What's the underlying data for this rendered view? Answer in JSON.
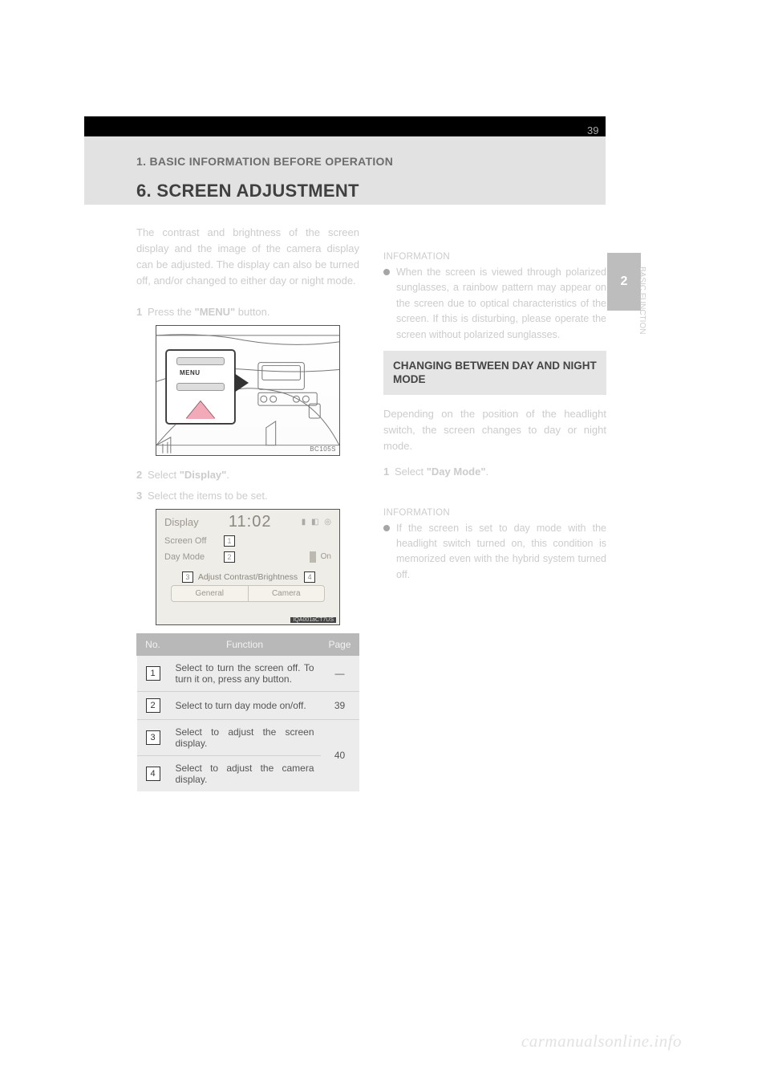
{
  "page": {
    "number": "39",
    "chapter_label": "1. BASIC INFORMATION BEFORE OPERATION",
    "section_title": "6. SCREEN ADJUSTMENT"
  },
  "side_tab": {
    "number": "2",
    "label": "BASIC FUNCTION"
  },
  "left": {
    "intro": "The contrast and brightness of the screen display and the image of the camera display can be adjusted. The display can also be turned off, and/or changed to either day or night mode.",
    "step1_num": "1",
    "step1_text_a": "Press the ",
    "step1_bold": "\"MENU\"",
    "step1_text_b": " button.",
    "fig1_label": "BC105S",
    "callout": {
      "button_label": "MENU"
    },
    "step2_num": "2",
    "step2_text_a": "Select ",
    "step2_bold": "\"Display\"",
    "step2_text_b": ".",
    "step3_num": "3",
    "step3_text": "Select the items to be set.",
    "screen": {
      "title": "Display",
      "clock": "11:02",
      "status_icons": "▮ ◧ ◎",
      "row1_label": "Screen Off",
      "marker1": "1",
      "row2_label": "Day Mode",
      "marker2": "2",
      "toggle_text": "On",
      "contrast_label": "Adjust Contrast/Brightness",
      "marker3": "3",
      "marker4": "4",
      "tab1": "General",
      "tab2": "Camera",
      "code": "IQA001aCT7US"
    },
    "table": {
      "h_no": "No.",
      "h_func": "Function",
      "h_page": "Page",
      "r1_no": "1",
      "r1_func": "Select to turn the screen off. To turn it on, press any button.",
      "r1_page": "—",
      "r2_no": "2",
      "r2_func": "Select to turn day mode on/off.",
      "r2_page": "39",
      "r3_no": "3",
      "r3_func": "Select to adjust the screen display.",
      "r34_page": "40",
      "r4_no": "4",
      "r4_func": "Select to adjust the camera display."
    }
  },
  "right": {
    "bullet1": "When the screen is viewed through polarized sunglasses, a rainbow pattern may appear on the screen due to optical characteristics of the screen. If this is disturbing, please operate the screen without polarized sunglasses.",
    "info_label": "INFORMATION",
    "subhead": "CHANGING BETWEEN DAY AND NIGHT MODE",
    "para1": "Depending on the position of the headlight switch, the screen changes to day or night mode.",
    "step1_num": "1",
    "step1_a": "Select ",
    "step1_bold": "\"Day Mode\"",
    "step1_b": ".",
    "bullet2": "If the screen is set to day mode with the headlight switch turned on, this condition is memorized even with the hybrid system turned off."
  },
  "watermark": "carmanualsonline.info"
}
